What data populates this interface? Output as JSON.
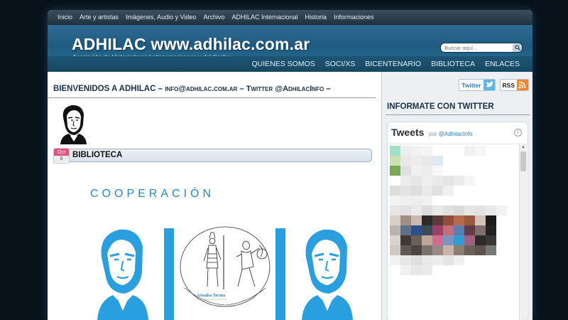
{
  "topnav": {
    "items": [
      "Inicio",
      "Arte y artistas",
      "Imágenes, Audio y Video",
      "Archivo",
      "ADHILAC Internacional",
      "Historia",
      "Informaciones"
    ]
  },
  "header": {
    "title": "ADHILAC www.adhilac.com.ar",
    "subtitle": "Asociación de Historiadores Latinoamericanos y del Caribe",
    "search_placeholder": "Buscar aquí..."
  },
  "mainnav": {
    "items": [
      "QUIENES SOMOS",
      "SOCI/XS",
      "BICENTENARIO",
      "BIBLIOTECA",
      "ENLACES"
    ]
  },
  "main": {
    "welcome_prefix": "BIENVENIDOS A ADHILAC –",
    "welcome_email": "info@adhilac.com.ar",
    "welcome_mid": "– Twitter",
    "welcome_handle": "@AdhilacInfo",
    "welcome_suffix": "–",
    "post": {
      "month": "Oct",
      "day": "6",
      "title": "BIBLIOTECA",
      "cooperation_heading": "COOPERACIÓN",
      "image_caption": "Ariadna Tucma"
    }
  },
  "sidebar": {
    "twitter_button": "Twitter",
    "rss_button": "RSS",
    "heading": "INFORMATE CON TWITTER",
    "tweets_title": "Tweets",
    "tweets_by": "por",
    "tweets_handle": "@AdhilacInfo",
    "info_symbol": "i"
  },
  "colors": {
    "header_blue": "#2a6d96",
    "accent_blue": "#2a86c6",
    "date_badge": "#d8567a"
  }
}
